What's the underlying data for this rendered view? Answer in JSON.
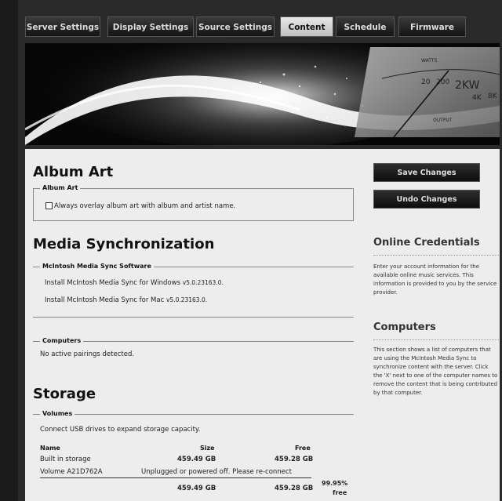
{
  "tabs": [
    {
      "label": "Server Settings",
      "active": false
    },
    {
      "label": "Display Settings",
      "active": false
    },
    {
      "label": "Source Settings",
      "active": false
    },
    {
      "label": "Content",
      "active": true
    },
    {
      "label": "Schedule",
      "active": false
    },
    {
      "label": "Firmware",
      "active": false
    }
  ],
  "banner": {
    "meter_labels": [
      "20",
      "200",
      "2KW",
      "4K",
      "8K",
      "WATTS",
      "OUTPUT"
    ]
  },
  "album_art": {
    "heading": "Album Art",
    "legend": "Album Art",
    "checkbox_label": "Always overlay album art with album and artist name.",
    "checked": false
  },
  "media_sync": {
    "heading": "Media Synchronization",
    "legend": "McIntosh Media Sync Software",
    "windows_prefix": "Install McIntosh Media Sync for Windows",
    "windows_version": "v5.0.23163.0.",
    "mac_prefix": "Install McIntosh Media Sync for Mac",
    "mac_version": "v5.0.23163.0."
  },
  "computers_box": {
    "legend": "Computers",
    "text": "No active pairings detected."
  },
  "storage": {
    "heading": "Storage",
    "legend": "Volumes",
    "intro": "Connect USB drives to expand storage capacity.",
    "columns": {
      "name": "Name",
      "size": "Size",
      "free": "Free"
    },
    "rows": [
      {
        "name": "Built in storage",
        "size": "459.49 GB",
        "free": "459.28 GB"
      },
      {
        "name": "Volume A21D762A",
        "status": "Unplugged or powered off. Please re-connect"
      }
    ],
    "total": {
      "size": "459.49 GB",
      "free": "459.28 GB",
      "percent": "99.95%",
      "percent_label": "free"
    }
  },
  "actions": {
    "save": "Save Changes",
    "undo": "Undo Changes"
  },
  "sidebar": {
    "online_title": "Online Credentials",
    "online_text": "Enter your account information for the available online music services. This information is provided to you by the service provider.",
    "computers_title": "Computers",
    "computers_text": "This section shows a list of computers that are using the McIntosh Media Sync to synchronize content with the server. Click the 'X' next to one of the computer names to remove the content that is being contributed by that computer."
  }
}
